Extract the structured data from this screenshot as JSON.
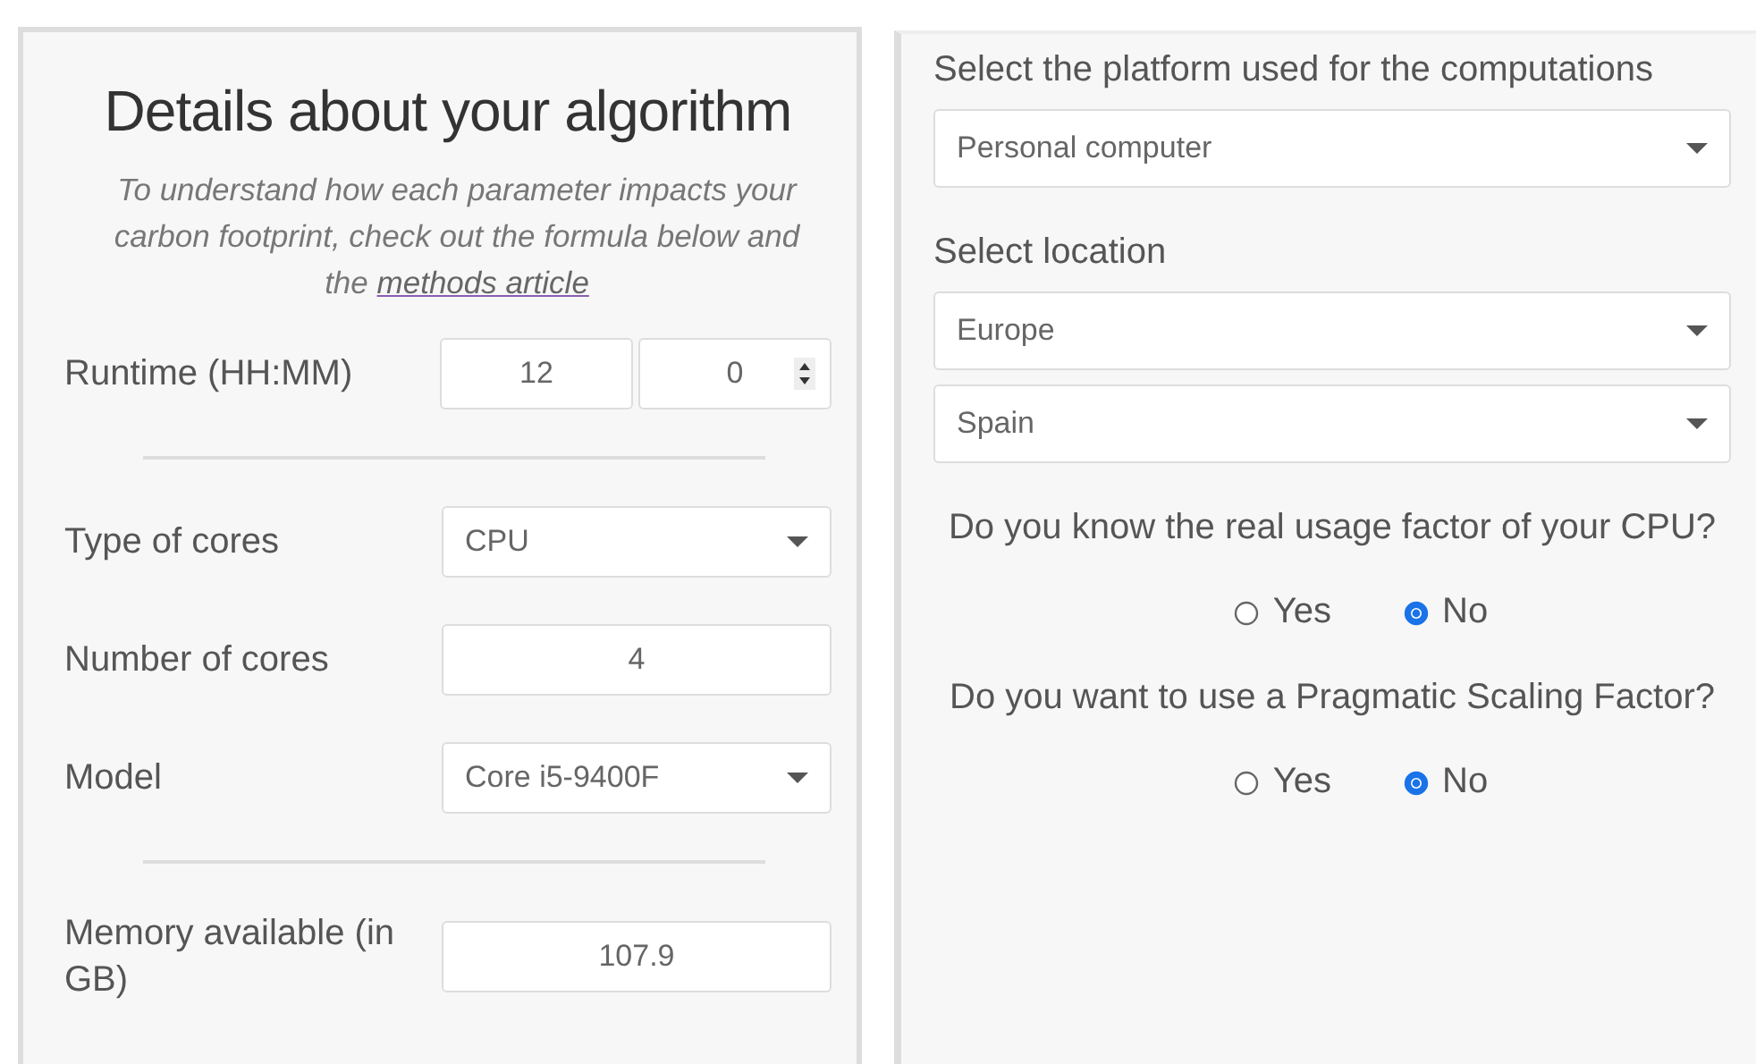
{
  "algorithm_panel": {
    "title": "Details about your algorithm",
    "intro": "To understand how each parameter impacts your carbon footprint, check out the formula below and the",
    "intro_link": "methods article",
    "field_groups": [
      [
        {
          "kind": "time",
          "label": "Runtime (HH:MM)",
          "hours": "12",
          "minutes": "0"
        }
      ],
      [
        {
          "kind": "select",
          "label": "Type of cores",
          "value": "CPU"
        },
        {
          "kind": "number",
          "label": "Number of cores",
          "value": "4"
        },
        {
          "kind": "select",
          "label": "Model",
          "value": "Core i5-9400F"
        }
      ],
      [
        {
          "kind": "number",
          "label": "Memory available (in GB)",
          "value": "107.9"
        }
      ]
    ]
  },
  "platform_panel": {
    "sections": [
      {
        "kind": "select",
        "label": "Select the platform used for the computations",
        "selects": [
          "Personal computer"
        ]
      },
      {
        "kind": "select",
        "label": "Select location",
        "selects": [
          "Europe",
          "Spain"
        ]
      },
      {
        "kind": "radio",
        "label": "Do you know the real usage factor of your CPU?",
        "options": [
          {
            "label": "Yes",
            "selected": false
          },
          {
            "label": "No",
            "selected": true
          }
        ]
      },
      {
        "kind": "radio",
        "label": "Do you want to use a Pragmatic Scaling Factor?",
        "options": [
          {
            "label": "Yes",
            "selected": false
          },
          {
            "label": "No",
            "selected": true
          }
        ]
      }
    ]
  }
}
